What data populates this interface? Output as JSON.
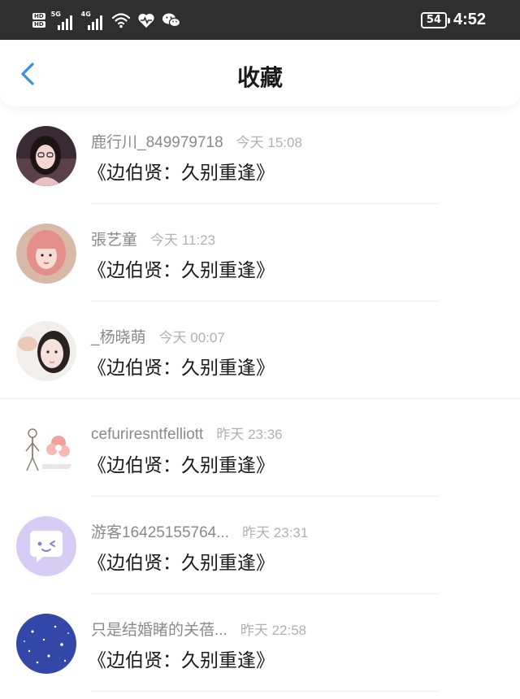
{
  "status_bar": {
    "hd_top": "HD",
    "hd_bottom": "HD",
    "sim1_gen": "5G",
    "sim2_gen": "4G",
    "icons": [
      "signal-icon",
      "wifi-icon",
      "health-heart-icon",
      "wechat-icon"
    ],
    "battery": "54",
    "time": "4:52"
  },
  "header": {
    "title": "收藏",
    "back_icon": "chevron-left-icon",
    "accent_color": "#3a8ee6"
  },
  "favorites": [
    {
      "username": "鹿行川_849979718",
      "time": "今天 15:08",
      "title": "《边伯贤：久别重逢》",
      "avatar": "photo-girl-glasses"
    },
    {
      "username": "張艺童",
      "time": "今天 11:23",
      "title": "《边伯贤：久别重逢》",
      "avatar": "photo-girl-pink-hair"
    },
    {
      "username": "_杨晓萌",
      "time": "今天 00:07",
      "title": "《边伯贤：久别重逢》",
      "avatar": "photo-girl-hand"
    },
    {
      "username": "cefuriresntfelliott",
      "time": "昨天 23:36",
      "title": "《边伯贤：久别重逢》",
      "avatar": "skeleton-and-flower"
    },
    {
      "username": "游客16425155764...",
      "time": "昨天 23:31",
      "title": "《边伯贤：久别重逢》",
      "avatar": "default-chat-bubble-avatar"
    },
    {
      "username": "只是结婚睹的关蓓...",
      "time": "昨天 22:58",
      "title": "《边伯贤：久别重逢》",
      "avatar": "blue-snow-pattern"
    }
  ]
}
